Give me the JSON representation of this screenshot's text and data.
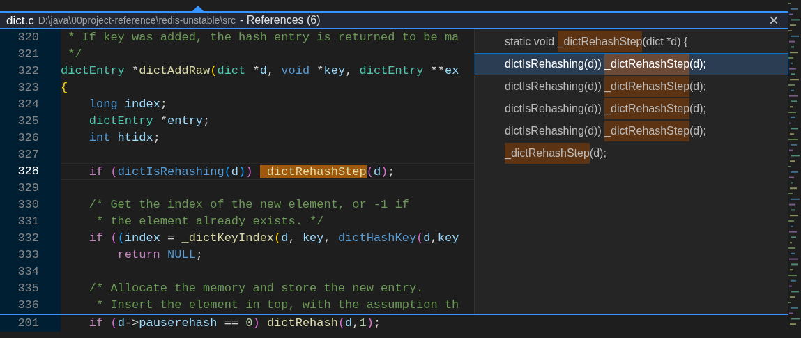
{
  "peek": {
    "file": "dict.c",
    "path": "D:\\java\\00project-reference\\redis-unstable\\src",
    "title": "- References (6)",
    "close": "×"
  },
  "code": [
    {
      "number": "320",
      "current": false,
      "tokens": [
        {
          "kind": "comment",
          "text": " * If key was added, the hash entry is returned to be ma"
        }
      ]
    },
    {
      "number": "321",
      "current": false,
      "tokens": [
        {
          "kind": "comment",
          "text": " */"
        }
      ]
    },
    {
      "number": "322",
      "current": false,
      "tokens": [
        {
          "kind": "type",
          "text": "dictEntry"
        },
        {
          "kind": "punct",
          "text": " *"
        },
        {
          "kind": "func",
          "text": "dictAddRaw"
        },
        {
          "kind": "brace",
          "text": "("
        },
        {
          "kind": "type",
          "text": "dict"
        },
        {
          "kind": "punct",
          "text": " *"
        },
        {
          "kind": "var",
          "text": "d"
        },
        {
          "kind": "punct",
          "text": ", "
        },
        {
          "kind": "storage",
          "text": "void"
        },
        {
          "kind": "punct",
          "text": " *"
        },
        {
          "kind": "var",
          "text": "key"
        },
        {
          "kind": "punct",
          "text": ", "
        },
        {
          "kind": "type",
          "text": "dictEntry"
        },
        {
          "kind": "punct",
          "text": " **"
        },
        {
          "kind": "var",
          "text": "ex"
        }
      ]
    },
    {
      "number": "323",
      "current": false,
      "tokens": [
        {
          "kind": "brace",
          "text": "{"
        }
      ]
    },
    {
      "number": "324",
      "current": false,
      "tokens": [
        {
          "kind": "storage",
          "text": "    long"
        },
        {
          "kind": "var",
          "text": " index"
        },
        {
          "kind": "punct",
          "text": ";"
        }
      ]
    },
    {
      "number": "325",
      "current": false,
      "tokens": [
        {
          "kind": "type",
          "text": "    dictEntry"
        },
        {
          "kind": "punct",
          "text": " *"
        },
        {
          "kind": "var",
          "text": "entry"
        },
        {
          "kind": "punct",
          "text": ";"
        }
      ]
    },
    {
      "number": "326",
      "current": false,
      "tokens": [
        {
          "kind": "storage",
          "text": "    int"
        },
        {
          "kind": "var",
          "text": " htidx"
        },
        {
          "kind": "punct",
          "text": ";"
        }
      ]
    },
    {
      "number": "327",
      "current": false
    },
    {
      "number": "328",
      "current": true,
      "tokens": [
        {
          "kind": "keyword",
          "text": "    if "
        },
        {
          "kind": "paren",
          "text": "("
        },
        {
          "kind": "storage",
          "text": "dictIsRehashing"
        },
        {
          "kind": "paren2",
          "text": "("
        },
        {
          "kind": "var",
          "text": "d"
        },
        {
          "kind": "paren2",
          "text": ")"
        },
        {
          "kind": "paren",
          "text": ") "
        },
        {
          "kind": "match",
          "text": "_dictRehashStep"
        },
        {
          "kind": "paren",
          "text": "("
        },
        {
          "kind": "var",
          "text": "d"
        },
        {
          "kind": "paren",
          "text": ")"
        },
        {
          "kind": "punct",
          "text": ";"
        }
      ]
    },
    {
      "number": "329",
      "current": false
    },
    {
      "number": "330",
      "current": false,
      "tokens": [
        {
          "kind": "comment",
          "text": "    /* Get the index of the new element, or -1 if"
        }
      ]
    },
    {
      "number": "331",
      "current": false,
      "tokens": [
        {
          "kind": "comment",
          "text": "     * the element already exists. */"
        }
      ]
    },
    {
      "number": "332",
      "current": false,
      "tokens": [
        {
          "kind": "keyword",
          "text": "    if "
        },
        {
          "kind": "paren",
          "text": "("
        },
        {
          "kind": "paren2",
          "text": "("
        },
        {
          "kind": "var",
          "text": "index"
        },
        {
          "kind": "punct",
          "text": " = "
        },
        {
          "kind": "func",
          "text": "_dictKeyIndex"
        },
        {
          "kind": "brace",
          "text": "("
        },
        {
          "kind": "var",
          "text": "d"
        },
        {
          "kind": "punct",
          "text": ", "
        },
        {
          "kind": "var",
          "text": "key"
        },
        {
          "kind": "punct",
          "text": ", "
        },
        {
          "kind": "storage",
          "text": "dictHashKey"
        },
        {
          "kind": "paren",
          "text": "("
        },
        {
          "kind": "var",
          "text": "d"
        },
        {
          "kind": "punct",
          "text": ","
        },
        {
          "kind": "var",
          "text": "key"
        }
      ]
    },
    {
      "number": "333",
      "current": false,
      "tokens": [
        {
          "kind": "keyword",
          "text": "        return "
        },
        {
          "kind": "storage",
          "text": "NULL"
        },
        {
          "kind": "punct",
          "text": ";"
        }
      ]
    },
    {
      "number": "334",
      "current": false
    },
    {
      "number": "335",
      "current": false,
      "tokens": [
        {
          "kind": "comment",
          "text": "    /* Allocate the memory and store the new entry."
        }
      ]
    },
    {
      "number": "336",
      "current": false,
      "tokens": [
        {
          "kind": "comment",
          "text": "     * Insert the element in top, with the assumption th"
        }
      ]
    }
  ],
  "references": [
    {
      "selected": false,
      "parts": [
        {
          "text": "static void ",
          "match": false
        },
        {
          "text": "_dictRehashStep",
          "match": true
        },
        {
          "text": "(dict *d) {",
          "match": false
        }
      ]
    },
    {
      "selected": true,
      "parts": [
        {
          "text": "dictIsRehashing(d)) ",
          "match": false
        },
        {
          "text": "_dictRehashStep",
          "match": true
        },
        {
          "text": "(d);",
          "match": false
        }
      ]
    },
    {
      "selected": false,
      "parts": [
        {
          "text": "dictIsRehashing(d)) ",
          "match": false
        },
        {
          "text": "_dictRehashStep",
          "match": true
        },
        {
          "text": "(d);",
          "match": false
        }
      ]
    },
    {
      "selected": false,
      "parts": [
        {
          "text": "dictIsRehashing(d)) ",
          "match": false
        },
        {
          "text": "_dictRehashStep",
          "match": true
        },
        {
          "text": "(d);",
          "match": false
        }
      ]
    },
    {
      "selected": false,
      "parts": [
        {
          "text": "dictIsRehashing(d)) ",
          "match": false
        },
        {
          "text": "_dictRehashStep",
          "match": true
        },
        {
          "text": "(d);",
          "match": false
        }
      ]
    },
    {
      "selected": false,
      "parts": [
        {
          "text": "_dictRehashStep",
          "match": true
        },
        {
          "text": "(d);",
          "match": false
        }
      ]
    }
  ],
  "editor_line": {
    "number": "201",
    "tokens": [
      {
        "kind": "keyword",
        "text": "    if "
      },
      {
        "kind": "paren",
        "text": "("
      },
      {
        "kind": "var",
        "text": "d"
      },
      {
        "kind": "punct",
        "text": "->"
      },
      {
        "kind": "var",
        "text": "pauserehash"
      },
      {
        "kind": "punct",
        "text": " == "
      },
      {
        "kind": "num",
        "text": "0"
      },
      {
        "kind": "paren",
        "text": ") "
      },
      {
        "kind": "func",
        "text": "dictRehash"
      },
      {
        "kind": "paren",
        "text": "("
      },
      {
        "kind": "var",
        "text": "d"
      },
      {
        "kind": "punct",
        "text": ","
      },
      {
        "kind": "num",
        "text": "1"
      },
      {
        "kind": "paren",
        "text": ")"
      },
      {
        "kind": "punct",
        "text": ";"
      }
    ]
  }
}
